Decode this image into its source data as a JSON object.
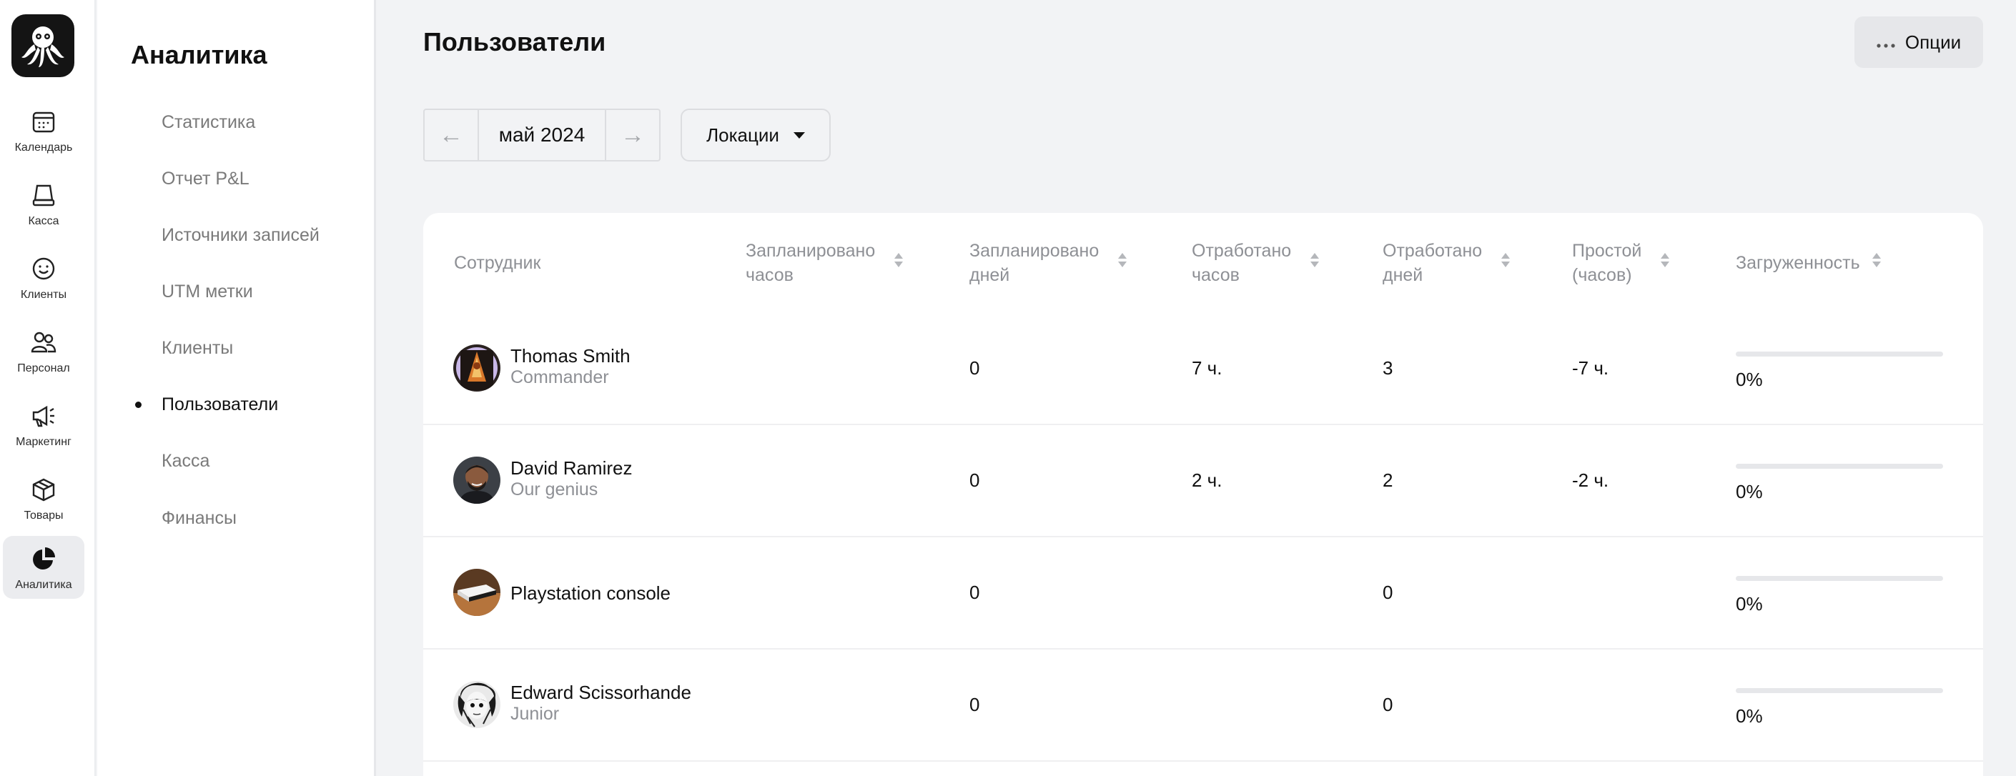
{
  "app": {
    "accent_color": "#111111",
    "nav": [
      {
        "label": "Календарь",
        "icon": "calendar-icon"
      },
      {
        "label": "Касса",
        "icon": "cash-register-icon"
      },
      {
        "label": "Клиенты",
        "icon": "smiley-icon"
      },
      {
        "label": "Персонал",
        "icon": "people-icon"
      },
      {
        "label": "Маркетинг",
        "icon": "megaphone-icon"
      },
      {
        "label": "Товары",
        "icon": "box-icon"
      },
      {
        "label": "Аналитика",
        "icon": "pie-chart-icon",
        "active": true
      }
    ]
  },
  "sidebar": {
    "title": "Аналитика",
    "items": [
      {
        "label": "Статистика"
      },
      {
        "label": "Отчет P&L"
      },
      {
        "label": "Источники записей"
      },
      {
        "label": "UTM метки"
      },
      {
        "label": "Клиенты"
      },
      {
        "label": "Пользователи",
        "active": true
      },
      {
        "label": "Касса"
      },
      {
        "label": "Финансы"
      }
    ]
  },
  "header": {
    "title": "Пользователи",
    "options_label": "Опции"
  },
  "filters": {
    "prev_arrow": "←",
    "next_arrow": "→",
    "month": "май 2024",
    "locations_label": "Локации"
  },
  "table": {
    "columns": [
      {
        "line1": "Сотрудник",
        "line2": "",
        "sortable": false
      },
      {
        "line1": "Запланировано",
        "line2": "часов",
        "sortable": true
      },
      {
        "line1": "Запланировано",
        "line2": "дней",
        "sortable": true
      },
      {
        "line1": "Отработано",
        "line2": "часов",
        "sortable": true
      },
      {
        "line1": "Отработано",
        "line2": "дней",
        "sortable": true
      },
      {
        "line1": "Простой",
        "line2": "(часов)",
        "sortable": true
      },
      {
        "line1": "Загруженность",
        "line2": "",
        "sortable": true
      }
    ],
    "rows": [
      {
        "name": "Thomas Smith",
        "role": "Commander",
        "planned_hours": "",
        "planned_days": "0",
        "worked_hours": "7 ч.",
        "worked_days": "3",
        "idle_hours": "-7 ч.",
        "load": "0%",
        "load_fraction": 0
      },
      {
        "name": "David Ramirez",
        "role": "Our genius",
        "planned_hours": "",
        "planned_days": "0",
        "worked_hours": "2 ч.",
        "worked_days": "2",
        "idle_hours": "-2 ч.",
        "load": "0%",
        "load_fraction": 0
      },
      {
        "name": "Playstation console",
        "role": "",
        "planned_hours": "",
        "planned_days": "0",
        "worked_hours": "",
        "worked_days": "0",
        "idle_hours": "",
        "load": "0%",
        "load_fraction": 0
      },
      {
        "name": "Edward Scissorhande",
        "role": "Junior",
        "planned_hours": "",
        "planned_days": "0",
        "worked_hours": "",
        "worked_days": "0",
        "idle_hours": "",
        "load": "0%",
        "load_fraction": 0
      }
    ]
  }
}
